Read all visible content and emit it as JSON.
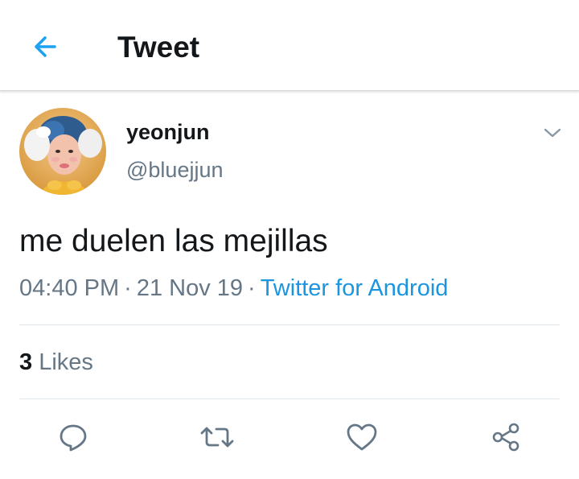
{
  "header": {
    "back_icon": "arrow-left-icon",
    "title": "Tweet"
  },
  "tweet": {
    "author": {
      "display_name": "yeonjun",
      "handle": "@bluejjun"
    },
    "text": "me duelen las mejillas",
    "time": "04:40 PM",
    "date": "21 Nov 19",
    "separator": "·",
    "source": "Twitter for Android",
    "likes_count": "3",
    "likes_label": "Likes"
  },
  "actions": [
    {
      "icon": "reply-icon"
    },
    {
      "icon": "retweet-icon"
    },
    {
      "icon": "like-icon"
    },
    {
      "icon": "share-icon"
    }
  ],
  "colors": {
    "accent": "#1da1f2",
    "link": "#1b95e0",
    "text": "#14171a",
    "secondary": "#657786",
    "icon": "#657786",
    "divider": "#e1e8ed"
  }
}
